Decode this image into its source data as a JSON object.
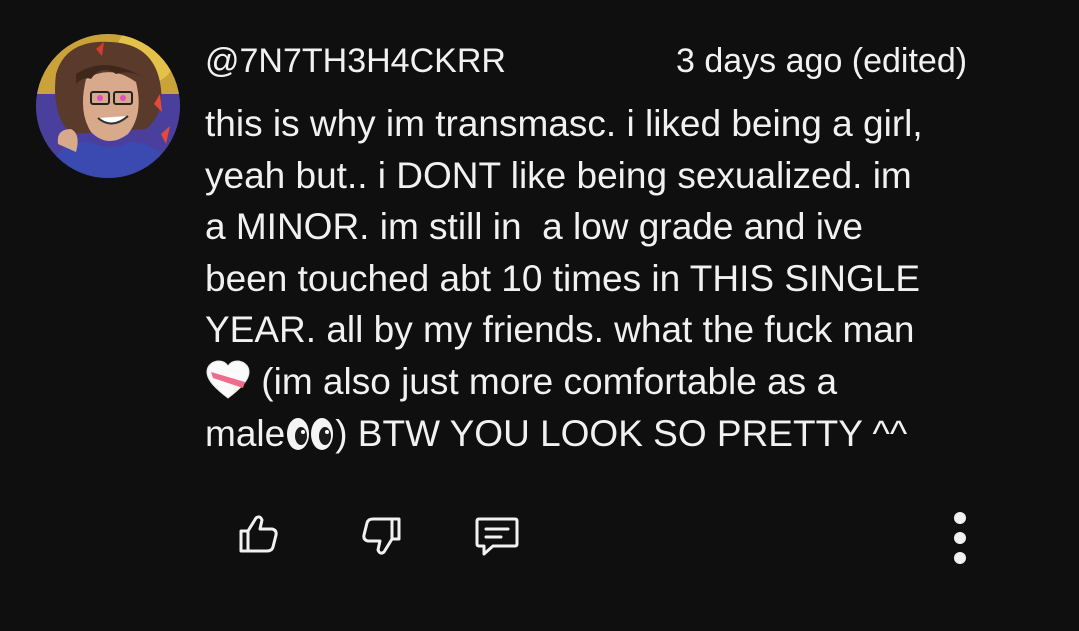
{
  "comment": {
    "author_handle": "@7N7TH3H4CKRR",
    "timestamp": "3 days ago (edited)",
    "lines": {
      "l1": "this is why im transmasc. i liked being a girl,",
      "l2": "yeah but.. i DONT like being sexualized. im",
      "l3": "a MINOR. im still in  a low grade and ive",
      "l4": "been touched abt 10 times in THIS SINGLE",
      "l5": "YEAR. all by my friends. what the fuck man",
      "l6_after_emoji": " (im also just more comfortable as a",
      "l7_before_emoji": "male",
      "l7_after_emoji": ") BTW YOU LOOK SO PRETTY ^^"
    },
    "emojis": {
      "heart": "heart-with-bandage-emoji (white and pink)",
      "eyes": "eyes-emoji"
    }
  },
  "actions": {
    "like_icon": "thumbs-up-icon",
    "dislike_icon": "thumbs-down-icon",
    "reply_icon": "reply-comment-icon",
    "more_icon": "vertical-dots-menu-icon"
  },
  "colors": {
    "background": "#0f0f0f",
    "text": "#f1f1f1",
    "icon": "#f1f1f1"
  }
}
